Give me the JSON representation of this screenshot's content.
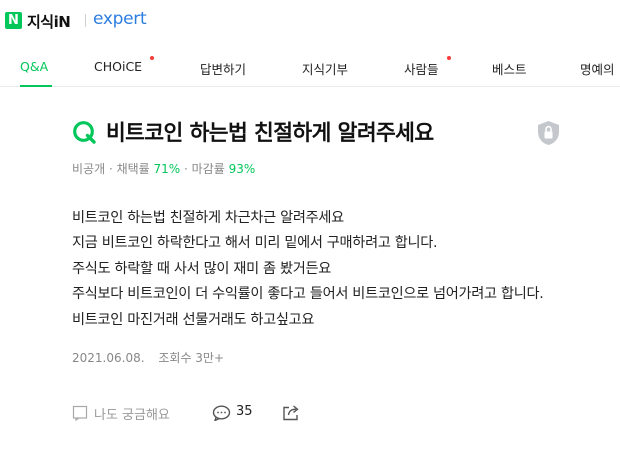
{
  "header": {
    "logo_badge": "N",
    "logo_text": "지식iN",
    "logo_sub": "expert"
  },
  "nav": {
    "items": [
      {
        "label": "Q&A",
        "active": true,
        "dot": false
      },
      {
        "label": "CHOiCE",
        "active": false,
        "dot": true
      },
      {
        "label": "답변하기",
        "active": false,
        "dot": false
      },
      {
        "label": "지식기부",
        "active": false,
        "dot": false
      },
      {
        "label": "사람들",
        "active": false,
        "dot": true
      },
      {
        "label": "베스트",
        "active": false,
        "dot": false
      },
      {
        "label": "명예의",
        "active": false,
        "dot": false
      }
    ]
  },
  "question": {
    "title": "비트코인 하는법 친절하게 알려주세요",
    "meta": {
      "visibility": "비공개",
      "adopt_label": "채택률",
      "adopt_rate": "71%",
      "deadline_label": "마감률",
      "deadline_rate": "93%"
    },
    "body_lines": [
      "비트코인 하는법 친절하게 차근차근 알려주세요",
      "지금 비트코인 하락한다고 해서 미리 밑에서 구매하려고 합니다.",
      "주식도 하락할 때 사서 많이 재미 좀 봤거든요",
      "주식보다 비트코인이 더 수익률이 좋다고 들어서 비트코인으로 넘어가려고 합니다.",
      "비트코인 마진거래 선물거래도 하고싶고요"
    ],
    "date": "2021.06.08.",
    "views": "조회수 3만+"
  },
  "actions": {
    "curious_label": "나도 궁금해요",
    "comment_count": "35"
  },
  "colors": {
    "brand_green": "#03c75a",
    "expert_blue": "#2e7ee0",
    "new_dot": "#ff3b3b"
  },
  "icons": {
    "question": "q-icon",
    "private": "lock-shield-icon",
    "curious": "memo-icon",
    "comment": "speech-bubble-icon",
    "share": "share-icon"
  }
}
